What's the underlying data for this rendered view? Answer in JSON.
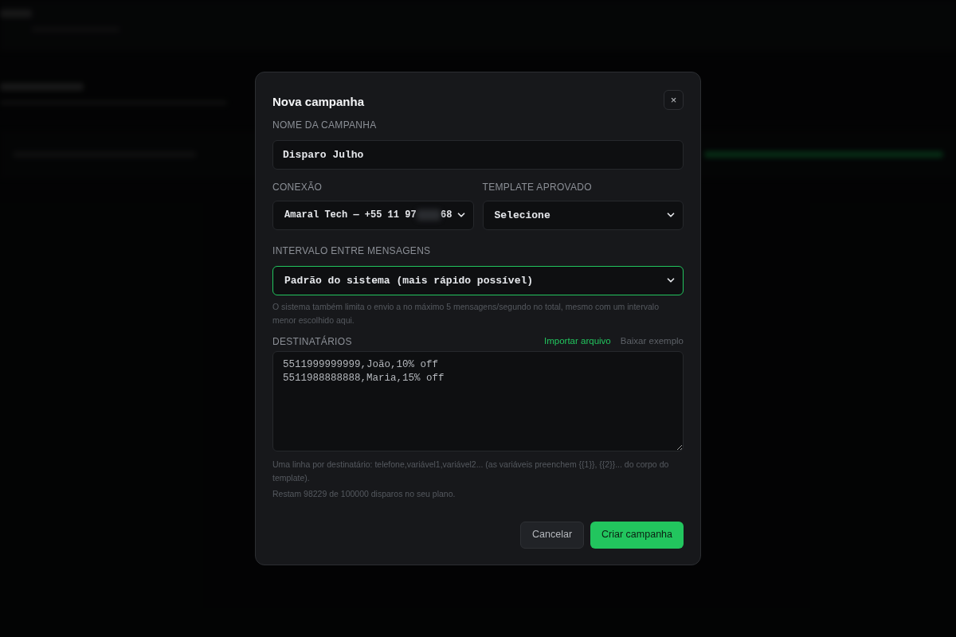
{
  "dialog": {
    "title": "Nova campanha",
    "close": "×"
  },
  "fields": {
    "name": {
      "label": "NOME DA CAMPANHA",
      "value": "Disparo Julho"
    },
    "connection": {
      "label": "CONEXÃO",
      "value_start": "Amaral Tech — +55 11 97",
      "value_end": "68",
      "redacted": true
    },
    "template": {
      "label": "TEMPLATE APROVADO",
      "value": "Selecione"
    },
    "interval": {
      "label": "INTERVALO ENTRE MENSAGENS",
      "value": "Padrão do sistema (mais rápido possível)",
      "focused": true,
      "hint": "O sistema também limita o envio a no máximo 5 mensagens/segundo no total, mesmo com um intervalo menor escolhido aqui."
    },
    "recipients": {
      "label": "DESTINATÁRIOS",
      "links": [
        {
          "label": "Importar arquivo",
          "kind": "primary"
        },
        {
          "label": "Baixar exemplo",
          "kind": "muted"
        }
      ],
      "lines": [
        "5511999999999,João,10% off",
        "5511988888888,Maria,15% off"
      ],
      "hint": "Uma linha por destinatário: telefone,variável1,variável2... (as variáveis preenchem {{1}}, {{2}}... do corpo do template).",
      "quota": "Restam 98229 de 100000 disparos no seu plano."
    }
  },
  "buttons": [
    {
      "label": "Cancelar",
      "kind": "secondary"
    },
    {
      "label": "Criar campanha",
      "kind": "primary"
    }
  ]
}
